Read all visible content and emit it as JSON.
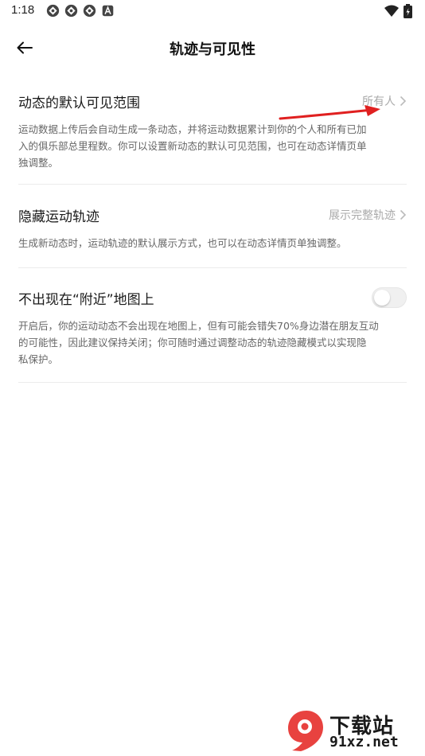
{
  "status_bar": {
    "time": "1:18"
  },
  "header": {
    "title": "轨迹与可见性"
  },
  "sections": [
    {
      "label": "动态的默认可见范围",
      "value": "所有人",
      "description": "运动数据上传后会自动生成一条动态，并将运动数据累计到你的个人和所有已加入的俱乐部总里程数。你可以设置新动态的默认可见范围，也可在动态详情页单独调整。",
      "desc_lines": [
        "运动数据上传后会自动生成一条动态，并将运动数据累计到你的个人和所有已加",
        "入的俱乐部总里程数。你可以设置新动态的默认可见范围，也可在动态详情页单",
        "独调整。"
      ]
    },
    {
      "label": "隐藏运动轨迹",
      "value": "展示完整轨迹",
      "description": "生成新动态时，运动轨迹的默认展示方式，也可以在动态详情页单独调整。"
    },
    {
      "label": "不出现在“附近”地图上",
      "toggle_on": false,
      "desc_lines": [
        "开启后，你的运动动态不会出现在地图上，但有可能会错失70%身边潜在朋友互动",
        "的可能性，因此建议保持关闭；你可随时通过调整动态的轨迹隐藏模式以实现隐",
        "私保护。"
      ]
    }
  ],
  "watermark": {
    "line1": "下载站",
    "line2": "91xz.net"
  },
  "colors": {
    "accent_arrow": "#e02020",
    "value_gray": "#aaaaaa",
    "watermark_red": "#e8423f"
  }
}
